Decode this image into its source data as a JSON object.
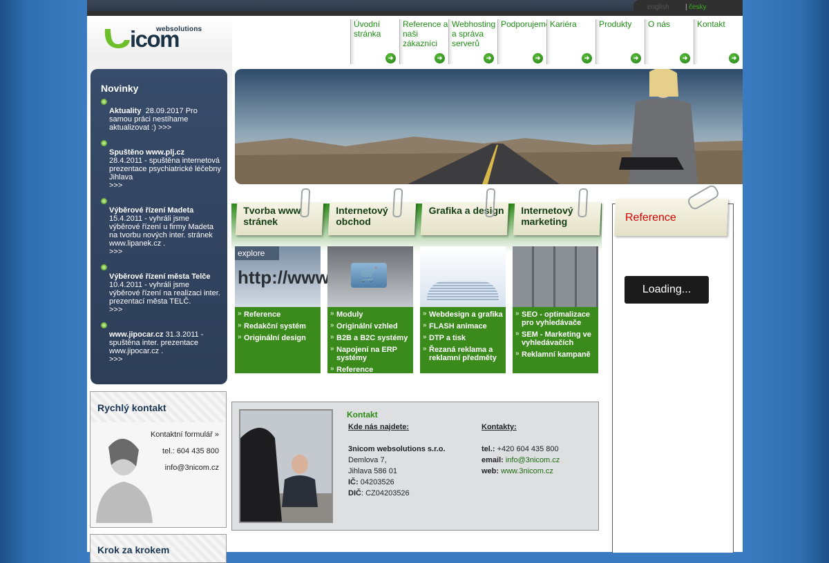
{
  "language": {
    "inactive": "english",
    "separator": "|",
    "active": "česky"
  },
  "logo": {
    "text": "icom",
    "tagline": "websolutions"
  },
  "nav": [
    {
      "label": "Úvodní stránka"
    },
    {
      "label": "Reference a naši zákazníci"
    },
    {
      "label": "Webhosting a správa serverů"
    },
    {
      "label": "Podporujeme"
    },
    {
      "label": "Kariéra"
    },
    {
      "label": "Produkty"
    },
    {
      "label": "O nás"
    },
    {
      "label": "Kontakt"
    }
  ],
  "news": {
    "title": "Novinky",
    "items": [
      {
        "title": "Aktuality",
        "text": "28.09.2017 Pro samou práci nestíhame aktualizovat :)",
        "more": ">>>"
      },
      {
        "title": "Spuštěno www.plj.cz",
        "text": "28.4.2011 - spuštěna internetová prezentace psychiatrické léčebny Jihlava",
        "more": ">>>"
      },
      {
        "title": "Výběrové řízení Madeta",
        "text": "15.4.2011 - vyhráli jsme výběrové řízení u firmy Madeta na tvorbu nových inter. stránek www.lipanek.cz .",
        "more": ">>>"
      },
      {
        "title": "Výběrové řízení města Telče",
        "text": "10.4.2011 - vyhráli jsme výběrové řízení na realizaci inter. prezentací města TELČ.",
        "more": ">>>"
      },
      {
        "title": "www.jipocar.cz",
        "text": "31.3.2011 - spuštěna inter. prezentace www.jipocar.cz .",
        "more": ">>>"
      }
    ]
  },
  "services": [
    {
      "title": "Tvorba www stránek",
      "image_caption": "explore",
      "image_text": "http://www.",
      "links": [
        "Reference",
        "Redakční systém",
        "Originální design"
      ]
    },
    {
      "title": "Internetový obchod",
      "links": [
        "Moduly",
        "Originální vzhled",
        "B2B a B2C systémy",
        "Napojení na ERP systémy",
        "Reference"
      ]
    },
    {
      "title": "Grafika a design",
      "links": [
        "Webdesign a grafika",
        "FLASH animace",
        "DTP a tisk",
        "Řezaná reklama a reklamní předměty"
      ]
    },
    {
      "title": "Internetový marketing",
      "links": [
        "SEO - optimalizace pro vyhledávače",
        "SEM - Marketing ve vyhledávačích",
        "Reklamní kampaně"
      ]
    }
  ],
  "reference": {
    "title": "Reference",
    "loading": "Loading..."
  },
  "quick_contact": {
    "title": "Rychlý kontakt",
    "form_link": "Kontaktní formulář »",
    "phone": "tel.: 604 435 800",
    "email": "info@3nicom.cz"
  },
  "step_by_step": {
    "title": "Krok za krokem"
  },
  "contact": {
    "title": "Kontakt",
    "where_heading": "Kde nás najdete:",
    "company": "3nicom websolutions s.r.o.",
    "street": "Demlova 7,",
    "city": "Jihlava 586 01",
    "ico_label": "IČ:",
    "ico": "04203526",
    "dic_label": "DIČ",
    "dic": ": CZ04203526",
    "contacts_heading": "Kontakty:",
    "tel_label": "tel.:",
    "tel": "+420 604 435 800",
    "email_label": "email:",
    "email": "info@3nicom.cz",
    "web_label": "web:",
    "web": "www.3nicom.cz"
  }
}
